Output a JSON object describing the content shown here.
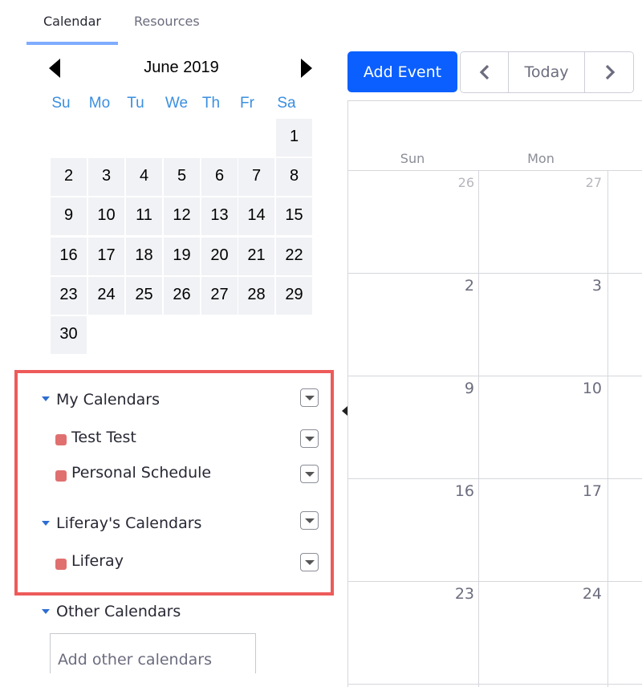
{
  "tabs": [
    {
      "label": "Calendar",
      "active": true
    },
    {
      "label": "Resources",
      "active": false
    }
  ],
  "mini_calendar": {
    "month_label": "June 2019",
    "weekdays": [
      "Su",
      "Mo",
      "Tu",
      "We",
      "Th",
      "Fr",
      "Sa"
    ],
    "days": [
      "1",
      "2",
      "3",
      "4",
      "5",
      "6",
      "7",
      "8",
      "9",
      "10",
      "11",
      "12",
      "13",
      "14",
      "15",
      "16",
      "17",
      "18",
      "19",
      "20",
      "21",
      "22",
      "23",
      "24",
      "25",
      "26",
      "27",
      "28",
      "29",
      "30"
    ]
  },
  "calendars": {
    "my_calendars": {
      "label": "My Calendars",
      "items": [
        {
          "label": "Test Test",
          "color": "#e07070"
        },
        {
          "label": "Personal Schedule",
          "color": "#e07070"
        }
      ]
    },
    "liferay_calendars": {
      "label": "Liferay's Calendars",
      "items": [
        {
          "label": "Liferay",
          "color": "#e07070"
        }
      ]
    },
    "other_calendars": {
      "label": "Other Calendars",
      "placeholder": "Add other calendars"
    }
  },
  "toolbar": {
    "add_event_label": "Add Event",
    "today_label": "Today",
    "prev_icon": "chevron-left-icon",
    "next_icon": "chevron-right-icon"
  },
  "month_view": {
    "day_headers": [
      "Sun",
      "Mon"
    ],
    "weeks": [
      [
        "26",
        "27"
      ],
      [
        "2",
        "3"
      ],
      [
        "9",
        "10"
      ],
      [
        "16",
        "17"
      ],
      [
        "23",
        "24"
      ]
    ]
  },
  "colors": {
    "accent": "#0b5fff",
    "highlight_border": "#ee5a5a",
    "weekday_text": "#3b8fe0"
  }
}
